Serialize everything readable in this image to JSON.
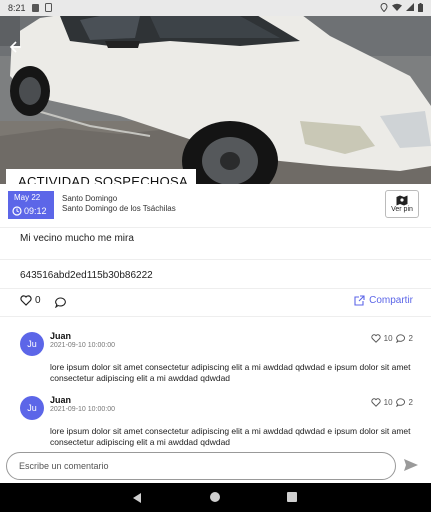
{
  "status_bar": {
    "time": "8:21"
  },
  "hero": {
    "label": "ACTIVIDAD SOSPECHOSA",
    "carousel_count": 2,
    "carousel_active_index": 0
  },
  "report": {
    "date_month": "May 22",
    "date_time": "09:12",
    "location_city": "Santo Domingo",
    "location_region": "Santo Domingo de los Tsáchilas",
    "map_button_label": "Ver pin",
    "description": "Mi vecino mucho me mira",
    "hash": "643516abd2ed115b30b86222"
  },
  "actions": {
    "likes": "0",
    "share_label": "Compartir"
  },
  "comments": [
    {
      "avatar": "Ju",
      "author": "Juan",
      "date": "2021-09-10 10:00:00",
      "likes": "10",
      "replies": "2",
      "text": "lore ipsum dolor sit amet consectetur adipiscing elit a mi awddad qdwdad e ipsum dolor sit amet consectetur adipiscing elit a mi awddad qdwdad"
    },
    {
      "avatar": "Ju",
      "author": "Juan",
      "date": "2021-09-10 10:00:00",
      "likes": "10",
      "replies": "2",
      "text": "lore ipsum dolor sit amet consectetur adipiscing elit a mi awddad qdwdad e ipsum dolor sit amet consectetur adipiscing elit a mi awddad qdwdad"
    }
  ],
  "comment_input": {
    "placeholder": "Escribe un comentario"
  },
  "colors": {
    "accent": "#5c66e8",
    "nav_bar": "#000000",
    "status_bar": "#e9e9e9"
  }
}
